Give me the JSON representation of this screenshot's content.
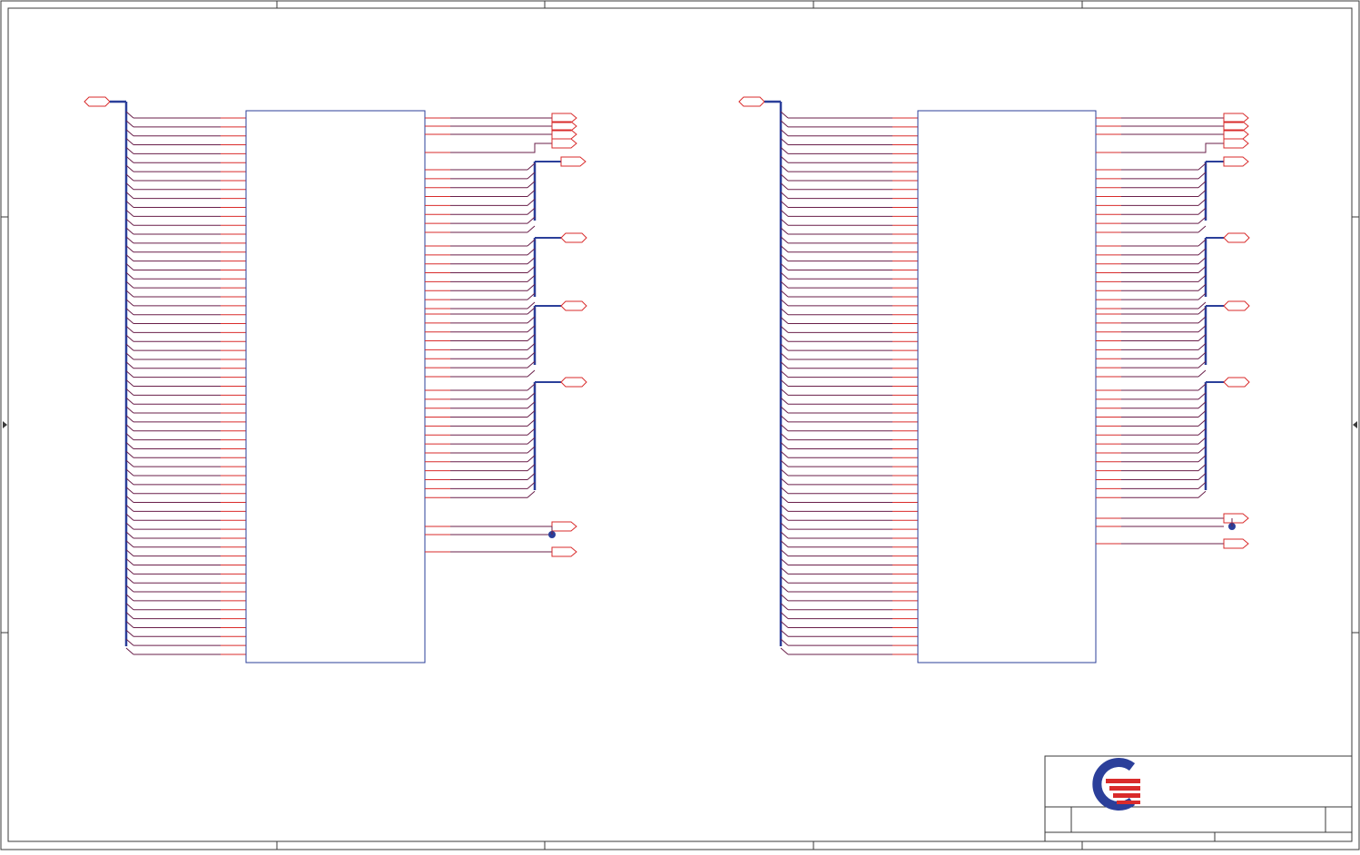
{
  "sheet": {
    "colors": {
      "border": "#3a3a3a",
      "bus": "#2b3f9a",
      "wire": "#d92b2b",
      "entry": "#6a1f4a",
      "component": "#2b3f9a",
      "port": "#d92b2b",
      "junction": "#2b3f9a",
      "logo_blue": "#2b3f9a",
      "logo_red": "#d92b2b"
    },
    "logo": {
      "icon": "company-logo-icon"
    },
    "schematics": [
      {
        "id": "left",
        "left_pin_count": 61
      },
      {
        "id": "right",
        "left_pin_count": 61
      }
    ]
  }
}
